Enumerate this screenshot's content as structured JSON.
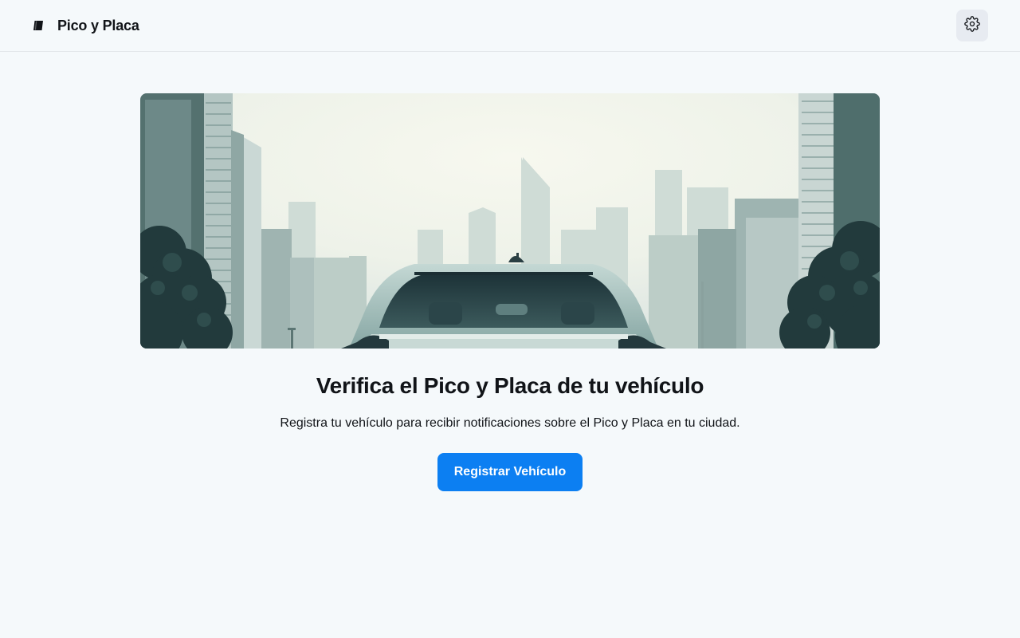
{
  "header": {
    "app_title": "Pico y Placa",
    "logo_icon": "brand-logo-icon",
    "settings_icon": "gear-icon"
  },
  "hero": {
    "image": "city-skyline-car-illustration"
  },
  "main": {
    "title": "Verifica el Pico y Placa de tu vehículo",
    "subtitle": "Registra tu vehículo para recibir notificaciones sobre el Pico y Placa en tu ciudad.",
    "cta_label": "Registrar Vehículo"
  },
  "colors": {
    "background": "#f5f9fb",
    "primary": "#0c7ff2",
    "text": "#111418",
    "settings_bg": "#e7ebf1"
  }
}
